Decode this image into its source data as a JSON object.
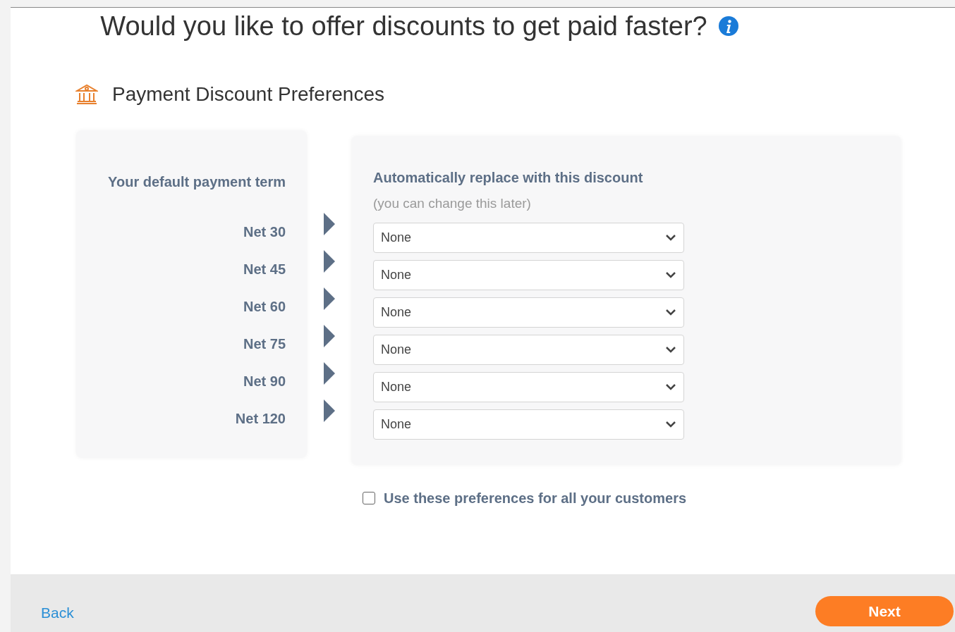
{
  "title": "Would you like to offer discounts to get paid faster?",
  "section": {
    "heading": "Payment Discount Preferences"
  },
  "left_panel": {
    "heading": "Your default payment term"
  },
  "right_panel": {
    "heading": "Automatically replace with this discount",
    "subheading": "(you can change this later)"
  },
  "rows": [
    {
      "term": "Net 30",
      "discount": "None"
    },
    {
      "term": "Net 45",
      "discount": "None"
    },
    {
      "term": "Net 60",
      "discount": "None"
    },
    {
      "term": "Net 75",
      "discount": "None"
    },
    {
      "term": "Net 90",
      "discount": "None"
    },
    {
      "term": "Net 120",
      "discount": "None"
    }
  ],
  "all_customers": {
    "label": "Use these preferences for all your customers",
    "checked": false
  },
  "footer": {
    "back": "Back",
    "next": "Next"
  }
}
